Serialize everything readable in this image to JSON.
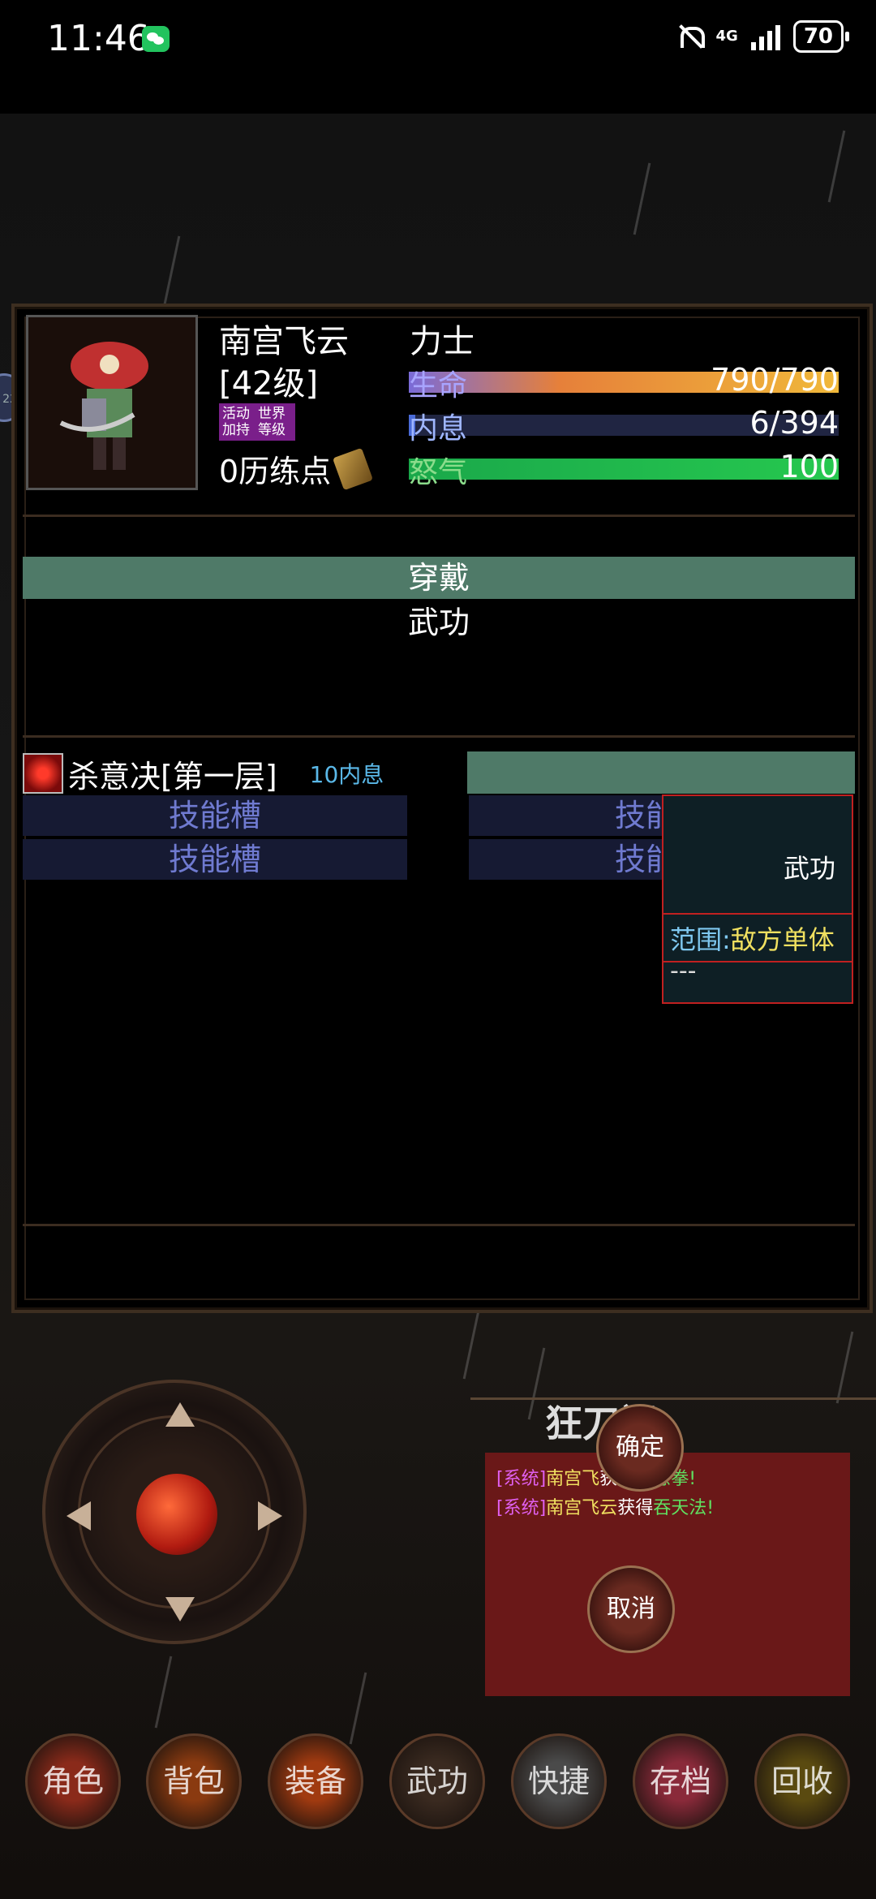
{
  "status_bar": {
    "time": "11:46",
    "network": "4G",
    "battery": "70"
  },
  "character": {
    "name": "南宫飞云",
    "class": "力士",
    "level": "[42级]",
    "buff_badge_line1_a": "活动",
    "buff_badge_line2_a": "加持",
    "buff_badge_line1_b": "世界",
    "buff_badge_line2_b": "等级",
    "training_points": "0历练点",
    "stats": {
      "hp_label": "生命",
      "hp_value": "790/790",
      "hp_fraction": 1.0,
      "mp_label": "内息",
      "mp_value": "6/394",
      "mp_fraction": 0.015,
      "rage_label": "怒气",
      "rage_value": "100",
      "rage_fraction": 1.0
    }
  },
  "tabs": {
    "wear": "穿戴",
    "martial": "武功"
  },
  "skills": {
    "equipped_name": "杀意决[第一层]",
    "equipped_cost": "10内息",
    "slot_label": "技能槽"
  },
  "tooltip": {
    "title": "武功",
    "range_key": "范围:",
    "range_value": "敌方单体",
    "extra": "---"
  },
  "chat": {
    "title": "狂刀阁",
    "messages": [
      {
        "tag": "[系统]",
        "who": "南宫飞",
        "text": "获得",
        "item": "形意拳!"
      },
      {
        "tag": "[系统]",
        "who": "南宫飞云",
        "text": "获得",
        "item": "吞天法!"
      }
    ]
  },
  "dialog": {
    "confirm": "确定",
    "cancel": "取消"
  },
  "bottom_nav": [
    {
      "label": "角色",
      "color": "#8a2a1a"
    },
    {
      "label": "背包",
      "color": "#8a3a10"
    },
    {
      "label": "装备",
      "color": "#a03a10"
    },
    {
      "label": "武功",
      "color": "#3a2a20"
    },
    {
      "label": "快捷",
      "color": "#4a4a4a"
    },
    {
      "label": "存档",
      "color": "#8a2a3a"
    },
    {
      "label": "回收",
      "color": "#5a4a10"
    }
  ],
  "colors": {
    "panel_bg": "#000000",
    "tab_active": "#4f7a68",
    "slot_bg": "#161a33",
    "tooltip_border": "#c02020"
  }
}
